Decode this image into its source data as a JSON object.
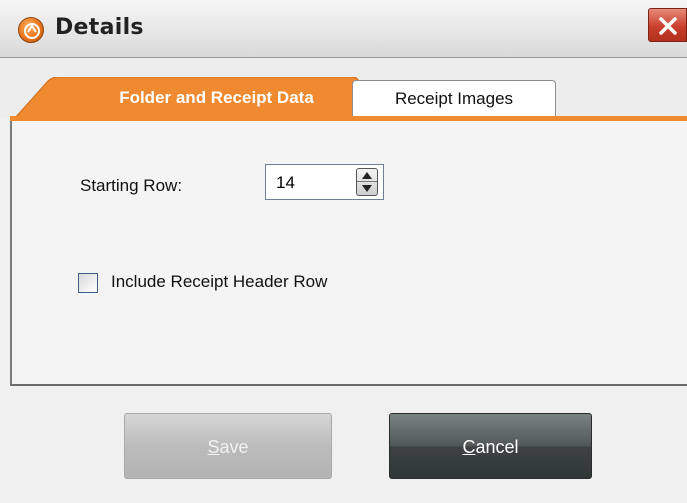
{
  "window": {
    "title": "Details",
    "icon": "app-logo-icon",
    "close_icon": "close-icon"
  },
  "tabs": [
    {
      "label": "Folder and Receipt Data",
      "active": true
    },
    {
      "label": "Receipt Images",
      "active": false
    }
  ],
  "form": {
    "starting_row_label": "Starting Row:",
    "starting_row_value": "14",
    "include_header_label": "Include Receipt Header Row",
    "include_header_checked": false
  },
  "buttons": {
    "save": {
      "mnemonic": "S",
      "rest": "ave",
      "enabled": false
    },
    "cancel": {
      "mnemonic": "C",
      "rest": "ancel",
      "enabled": true
    }
  },
  "colors": {
    "accent": "#f08a30",
    "close": "#c9402d"
  }
}
